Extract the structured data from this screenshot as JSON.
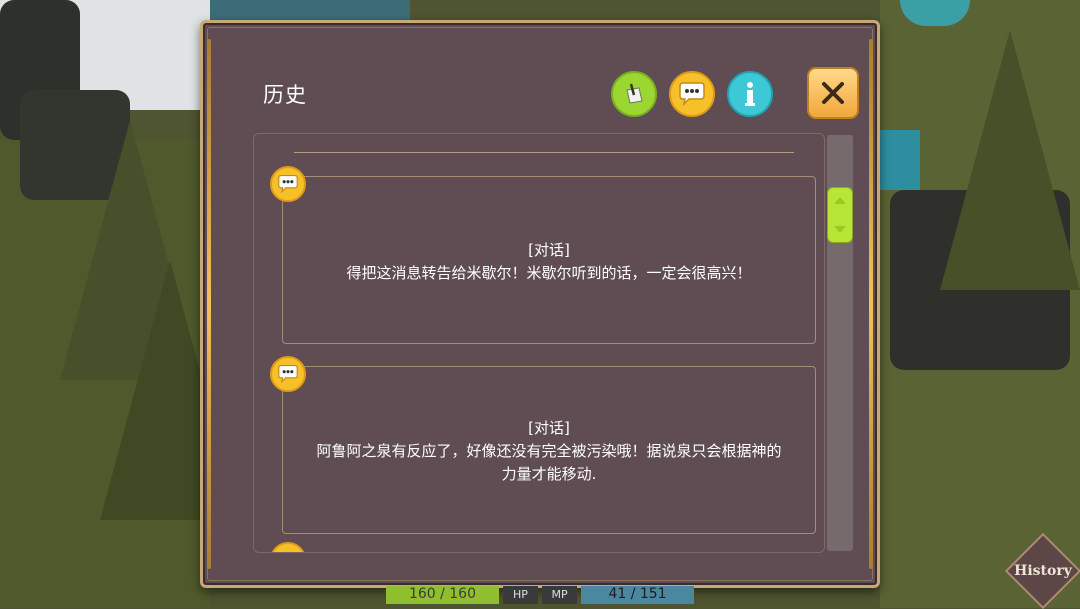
{
  "panel": {
    "title": "历史",
    "icons": [
      {
        "name": "note-filter-icon",
        "color": "#9bd631"
      },
      {
        "name": "chat-filter-icon",
        "color": "#f6c02a"
      },
      {
        "name": "info-filter-icon",
        "color": "#3ec7d4"
      }
    ],
    "close_icon": "close-icon"
  },
  "entries": [
    {
      "type_label": "[对话]",
      "lines": [
        "得把这消息转告给米歇尔！米歇尔听到的话，一定会很高兴！"
      ],
      "icon": "speech-bubble-icon"
    },
    {
      "type_label": "[对话]",
      "lines": [
        "阿鲁阿之泉有反应了，好像还没有完全被污染哦！据说泉只会根据神的",
        "力量才能移动."
      ],
      "icon": "speech-bubble-icon"
    }
  ],
  "hud": {
    "hp_text": "160 / 160",
    "hp_label": "HP",
    "mp_label": "MP",
    "mp_text": "41 / 151"
  },
  "history_button": {
    "label": "History"
  }
}
